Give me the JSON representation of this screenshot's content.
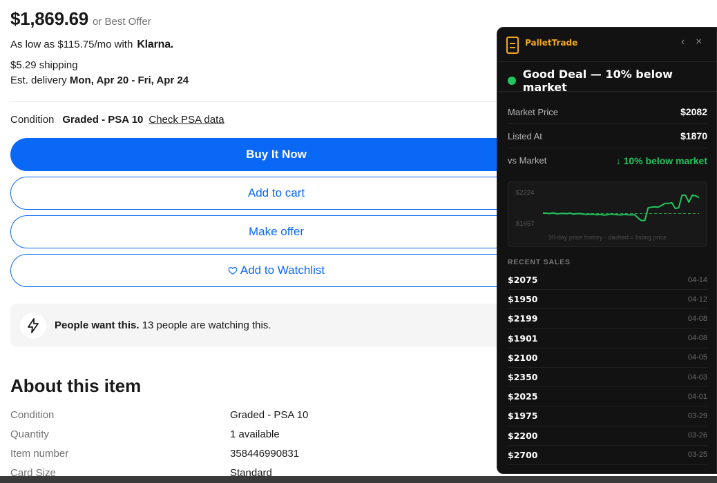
{
  "listing": {
    "price": "$1,869.69",
    "best_offer": "or Best Offer",
    "klarna_text": "As low as $115.75/mo with",
    "klarna_brand": "Klarna.",
    "shipping": "$5.29 shipping",
    "delivery_label": "Est. delivery",
    "delivery_dates": "Mon, Apr 20 - Fri, Apr 24",
    "condition_label": "Condition",
    "condition_value": "Graded - PSA 10",
    "condition_link": "Check PSA data",
    "buy_now": "Buy It Now",
    "add_to_cart": "Add to cart",
    "make_offer": "Make offer",
    "add_to_watchlist": "Add to Watchlist",
    "people_bold": "People want this.",
    "people_rest": "13 people are watching this."
  },
  "about": {
    "title": "About this item",
    "specs": [
      {
        "label": "Condition",
        "value": "Graded - PSA 10"
      },
      {
        "label": "Quantity",
        "value": "1 available"
      },
      {
        "label": "Item number",
        "value": "358446990831"
      },
      {
        "label": "Card Size",
        "value": "Standard"
      }
    ]
  },
  "panel": {
    "brand": "PalletTrade",
    "back_glyph": "‹",
    "close_glyph": "×",
    "deal_text": "Good Deal — 10% below market",
    "stats": [
      {
        "label": "Market Price",
        "value": "$2082"
      },
      {
        "label": "Listed At",
        "value": "$1870"
      },
      {
        "label": "vs Market",
        "value": "↓ 10% below market"
      }
    ],
    "chart_caption": "90-day price history · dashed = listing price",
    "chart_y_max_label": "$2224",
    "chart_y_min_label": "$1657",
    "recent_title": "RECENT SALES",
    "sales": [
      {
        "price": "$2075",
        "date": "04-14"
      },
      {
        "price": "$1950",
        "date": "04-12"
      },
      {
        "price": "$2199",
        "date": "04-08"
      },
      {
        "price": "$1901",
        "date": "04-08"
      },
      {
        "price": "$2100",
        "date": "04-05"
      },
      {
        "price": "$2350",
        "date": "04-03"
      },
      {
        "price": "$2025",
        "date": "04-01"
      },
      {
        "price": "$1975",
        "date": "03-29"
      },
      {
        "price": "$2200",
        "date": "03-26"
      },
      {
        "price": "$2700",
        "date": "03-25"
      }
    ]
  },
  "colors": {
    "accent_blue": "#0968f6",
    "deal_green": "#22c55e",
    "brand_orange": "#f5a623"
  },
  "chart_data": {
    "type": "line",
    "ylim": [
      1657,
      2224
    ],
    "listing_price": 1870,
    "values": [
      1880,
      1875,
      1870,
      1880,
      1865,
      1870,
      1872,
      1868,
      1875,
      1862,
      1868,
      1870,
      1860,
      1855,
      1860,
      1858,
      1850,
      1855,
      1845,
      1850,
      1862,
      1855,
      1850,
      1848,
      1855,
      1850,
      1848,
      1852,
      1800,
      1760,
      1760,
      1960,
      1970,
      1975,
      1970,
      2000,
      2030,
      2030,
      2040,
      1950,
      1960,
      2160,
      2160,
      2050,
      2160,
      2150,
      2120
    ]
  }
}
